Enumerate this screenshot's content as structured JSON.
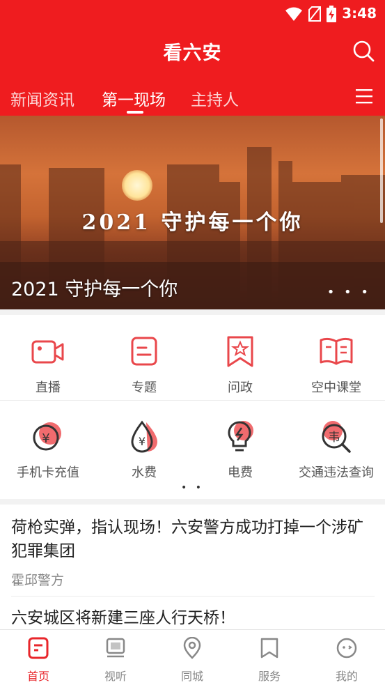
{
  "status_bar": {
    "time": "3:48"
  },
  "header": {
    "title": "看六安"
  },
  "tabs": [
    {
      "label": "新闻资讯"
    },
    {
      "label": "第一现场"
    },
    {
      "label": "主持人"
    }
  ],
  "banner": {
    "overlay_text": "2021  守护每一个你",
    "caption": "2021 守护每一个你",
    "dots": "• • •"
  },
  "services_row1": [
    {
      "label": "直播",
      "icon": "video-camera-icon"
    },
    {
      "label": "专题",
      "icon": "topic-icon"
    },
    {
      "label": "问政",
      "icon": "bookmark-star-icon"
    },
    {
      "label": "空中课堂",
      "icon": "open-book-icon"
    }
  ],
  "services_row2": [
    {
      "label": "手机卡充值",
      "icon": "yuan-refresh-icon"
    },
    {
      "label": "水费",
      "icon": "water-drop-yuan-icon"
    },
    {
      "label": "电费",
      "icon": "lightbulb-icon"
    },
    {
      "label": "交通违法查询",
      "icon": "traffic-search-icon"
    }
  ],
  "pager_dots": "• •",
  "news": [
    {
      "title": "荷枪实弹，指认现场！六安警方成功打掉一个涉矿犯罪集团",
      "source": "霍邱警方"
    },
    {
      "title": "六安城区将新建三座人行天桥！",
      "source": ""
    }
  ],
  "tabbar": [
    {
      "label": "首页",
      "icon": "home-doc-icon",
      "active": true
    },
    {
      "label": "视听",
      "icon": "monitor-icon",
      "active": false
    },
    {
      "label": "同城",
      "icon": "location-pin-icon",
      "active": false
    },
    {
      "label": "服务",
      "icon": "service-bookmark-icon",
      "active": false
    },
    {
      "label": "我的",
      "icon": "profile-face-icon",
      "active": false
    }
  ],
  "colors": {
    "brand_red": "#ef1c1f",
    "icon_red": "#e9474b",
    "active_tab": "#e8262b"
  }
}
